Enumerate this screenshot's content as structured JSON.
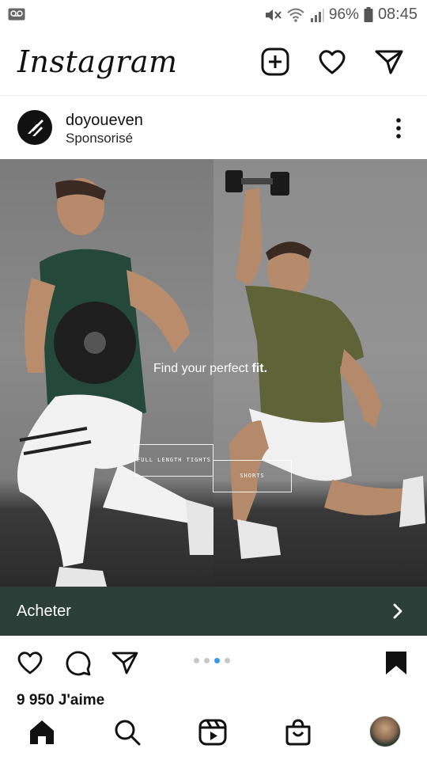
{
  "status_bar": {
    "battery": "96%",
    "time": "08:45",
    "icons": [
      "voicemail-icon",
      "mute-icon",
      "wifi-icon",
      "signal-icon",
      "battery-icon"
    ]
  },
  "app": {
    "title": "Instagram",
    "header_icons": [
      "new-post-icon",
      "heart-icon",
      "direct-message-icon"
    ]
  },
  "post": {
    "username": "doyoueven",
    "sponsored_label": "Sponsorisé",
    "image": {
      "caption_text": "Find your perfect ",
      "caption_bold": "fit.",
      "tags": [
        {
          "label": "FULL LENGTH TIGHTS"
        },
        {
          "label": "SHORTS"
        }
      ]
    },
    "cta_label": "Acheter",
    "carousel": {
      "count": 4,
      "active_index": 2
    },
    "likes": "9 950 J'aime"
  },
  "colors": {
    "cta_background": "#2b3e38",
    "active_dot": "#3897f0"
  },
  "bottom_nav": [
    "home-icon",
    "search-icon",
    "reels-icon",
    "shop-icon",
    "profile-avatar"
  ]
}
